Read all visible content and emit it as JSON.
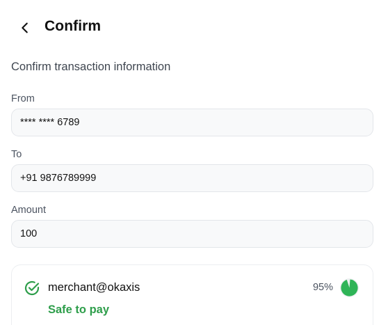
{
  "header": {
    "title": "Confirm"
  },
  "subtitle": "Confirm transaction information",
  "fields": {
    "from": {
      "label": "From",
      "value": "**** **** 6789"
    },
    "to": {
      "label": "To",
      "value": "+91 9876789999"
    },
    "amount": {
      "label": "Amount",
      "value": "100"
    }
  },
  "safety_card": {
    "merchant": "merchant@okaxis",
    "status": "Safe to pay",
    "score_text": "95%",
    "score_fraction": 0.95,
    "icons": {
      "status": "check-circle-icon",
      "gauge": "safety-score-gauge"
    }
  },
  "colors": {
    "accent_green": "#2e9e4b",
    "gauge_green": "#2fb457",
    "field_background": "#f8f9fa",
    "field_border": "#e3e6ea"
  }
}
